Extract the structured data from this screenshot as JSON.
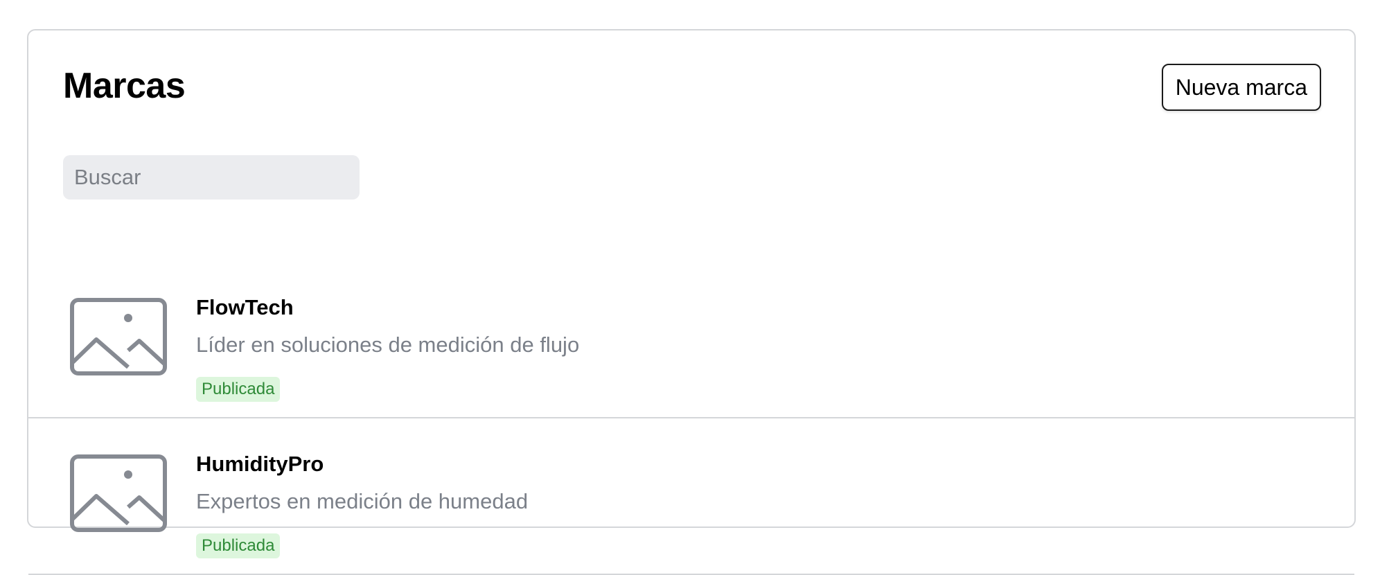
{
  "header": {
    "title": "Marcas",
    "new_button_label": "Nueva marca"
  },
  "search": {
    "placeholder": "Buscar",
    "value": ""
  },
  "brands": [
    {
      "name": "FlowTech",
      "description": "Líder en soluciones de medición de flujo",
      "status": "Publicada",
      "icon": "image-placeholder-icon"
    },
    {
      "name": "HumidityPro",
      "description": "Expertos en medición de humedad",
      "status": "Publicada",
      "icon": "image-placeholder-icon"
    }
  ],
  "colors": {
    "badge_bg": "#ddf6dd",
    "badge_text": "#2e8a37",
    "border": "#d4d6d9",
    "search_bg": "#ebecef"
  }
}
